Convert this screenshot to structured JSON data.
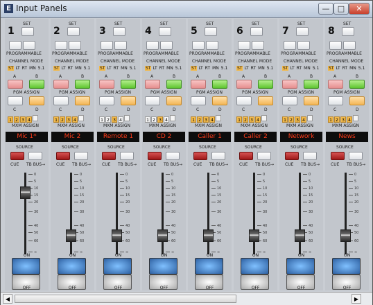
{
  "window": {
    "title": "Input Panels",
    "minimize": "—",
    "maximize": "□",
    "close": "✕"
  },
  "labels": {
    "set": "SET",
    "programmable": "PROGRAMMABLE",
    "channel_mode": "CHANNEL MODE",
    "a": "A",
    "b": "B",
    "pgm_assign": "PGM ASSIGN",
    "c": "C",
    "d": "D",
    "mxm_assign": "MXM ASSIGN",
    "source": "SOURCE",
    "cue": "CUE",
    "tb_bus": "TB BUS→",
    "on": "ON",
    "off": "OFF"
  },
  "channel_modes": [
    "ST",
    "LT",
    "RT",
    "MN",
    "5.1"
  ],
  "mxm_numbers": [
    "1",
    "2",
    "3",
    "4"
  ],
  "fader_scale": [
    "0",
    "5",
    "10",
    "15",
    "20",
    "30",
    "40",
    "50",
    "60",
    "∞"
  ],
  "channels": [
    {
      "number": "1",
      "source_name": "Mic 1*",
      "mode_active": "ST",
      "mxm_active": [
        "1",
        "2",
        "3",
        "4"
      ]
    },
    {
      "number": "2",
      "source_name": "Mic 2",
      "mode_active": "ST",
      "mxm_active": [
        "1",
        "2",
        "3",
        "4"
      ]
    },
    {
      "number": "3",
      "source_name": "Remote 1",
      "mode_active": "ST",
      "mxm_active": [
        "3"
      ]
    },
    {
      "number": "4",
      "source_name": "CD 2",
      "mode_active": "ST",
      "mxm_active": [
        "3"
      ]
    },
    {
      "number": "5",
      "source_name": "Caller 1",
      "mode_active": "ST",
      "mxm_active": [
        "1",
        "2",
        "3",
        "4"
      ]
    },
    {
      "number": "6",
      "source_name": "Caller 2",
      "mode_active": "ST",
      "mxm_active": [
        "1",
        "2",
        "3",
        "4"
      ]
    },
    {
      "number": "7",
      "source_name": "Network",
      "mode_active": "ST",
      "mxm_active": [
        "1",
        "2",
        "3",
        "4"
      ]
    },
    {
      "number": "8",
      "source_name": "News",
      "mode_active": "ST",
      "mxm_active": [
        "1",
        "2",
        "3",
        "4"
      ]
    }
  ],
  "colors": {
    "display_text": "#ff3b1a",
    "on_button": "#2d5fa0",
    "active_tag": "#f2b94a"
  },
  "scrollbar": {
    "left_arrow": "◀",
    "right_arrow": "▶"
  }
}
